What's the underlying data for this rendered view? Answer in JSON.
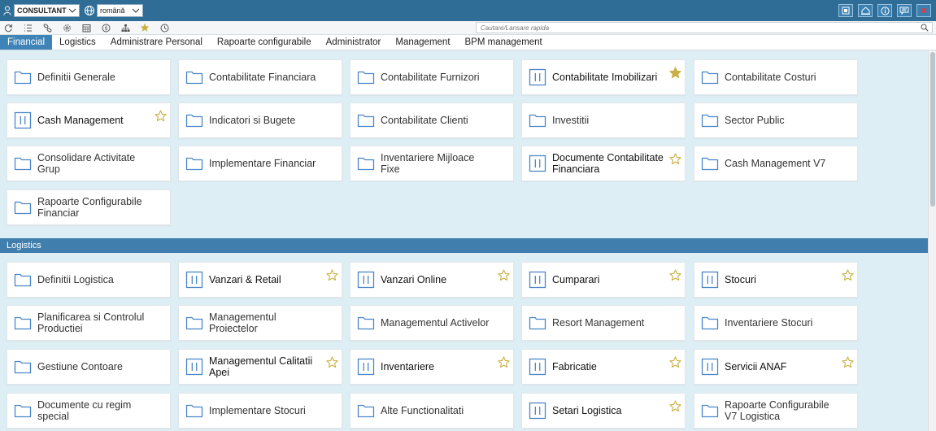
{
  "header": {
    "role_select": "CONSULTANT",
    "language_select": "română",
    "buttons": [
      "window-icon",
      "home-icon",
      "info-icon",
      "message-icon",
      "close-icon"
    ]
  },
  "toolbar": {
    "icons": [
      "refresh-icon",
      "list-icon",
      "link-icon",
      "settings-icon",
      "calendar-icon",
      "currency-icon",
      "org-chart-icon",
      "star-icon",
      "clock-icon"
    ],
    "search_placeholder": "Cautare/Lansare rapida"
  },
  "tabs": [
    {
      "label": "Financial",
      "active": true
    },
    {
      "label": "Logistics",
      "active": false
    },
    {
      "label": "Administrare Personal",
      "active": false
    },
    {
      "label": "Rapoarte configurabile",
      "active": false
    },
    {
      "label": "Administrator",
      "active": false
    },
    {
      "label": "Management",
      "active": false
    },
    {
      "label": "BPM management",
      "active": false
    }
  ],
  "sections": {
    "financial": {
      "tiles": [
        {
          "label": "Definitii Generale",
          "kind": "folder",
          "star": "none"
        },
        {
          "label": "Contabilitate Financiara",
          "kind": "folder",
          "star": "none"
        },
        {
          "label": "Contabilitate Furnizori",
          "kind": "folder",
          "star": "none"
        },
        {
          "label": "Contabilitate Imobilizari",
          "kind": "app",
          "star": "filled"
        },
        {
          "label": "Contabilitate Costuri",
          "kind": "folder",
          "star": "none"
        },
        {
          "label": "Cash Management",
          "kind": "app",
          "star": "outline"
        },
        {
          "label": "Indicatori si Bugete",
          "kind": "folder",
          "star": "none"
        },
        {
          "label": "Contabilitate Clienti",
          "kind": "folder",
          "star": "none"
        },
        {
          "label": "Investitii",
          "kind": "folder",
          "star": "none"
        },
        {
          "label": "Sector Public",
          "kind": "folder",
          "star": "none"
        },
        {
          "label": "Consolidare Activitate Grup",
          "kind": "folder",
          "star": "none"
        },
        {
          "label": "Implementare Financiar",
          "kind": "folder",
          "star": "none"
        },
        {
          "label": "Inventariere Mijloace Fixe",
          "kind": "folder",
          "star": "none"
        },
        {
          "label": "Documente Contabilitate Financiara",
          "kind": "app",
          "star": "outline"
        },
        {
          "label": "Cash Management V7",
          "kind": "folder",
          "star": "none"
        },
        {
          "label": "Rapoarte Configurabile Financiar",
          "kind": "folder",
          "star": "none"
        }
      ]
    },
    "logistics": {
      "title": "Logistics",
      "tiles": [
        {
          "label": "Definitii Logistica",
          "kind": "folder",
          "star": "none"
        },
        {
          "label": "Vanzari & Retail",
          "kind": "app",
          "star": "outline"
        },
        {
          "label": "Vanzari Online",
          "kind": "app",
          "star": "outline"
        },
        {
          "label": "Cumparari",
          "kind": "app",
          "star": "outline"
        },
        {
          "label": "Stocuri",
          "kind": "app",
          "star": "outline"
        },
        {
          "label": "Planificarea si Controlul Productiei",
          "kind": "folder",
          "star": "none"
        },
        {
          "label": "Managementul Proiectelor",
          "kind": "folder",
          "star": "none"
        },
        {
          "label": "Managementul Activelor",
          "kind": "folder",
          "star": "none"
        },
        {
          "label": "Resort Management",
          "kind": "folder",
          "star": "none"
        },
        {
          "label": "Inventariere Stocuri",
          "kind": "folder",
          "star": "none"
        },
        {
          "label": "Gestiune Contoare",
          "kind": "folder",
          "star": "none"
        },
        {
          "label": "Managementul Calitatii Apei",
          "kind": "app",
          "star": "outline"
        },
        {
          "label": "Inventariere",
          "kind": "app",
          "star": "outline"
        },
        {
          "label": "Fabricatie",
          "kind": "app",
          "star": "outline"
        },
        {
          "label": "Servicii ANAF",
          "kind": "app",
          "star": "outline"
        },
        {
          "label": "Documente cu regim special",
          "kind": "folder",
          "star": "none"
        },
        {
          "label": "Implementare Stocuri",
          "kind": "folder",
          "star": "none"
        },
        {
          "label": "Alte Functionalitati",
          "kind": "folder",
          "star": "none"
        },
        {
          "label": "Setari Logistica",
          "kind": "app",
          "star": "outline"
        },
        {
          "label": "Rapoarte Configurabile V7 Logistica",
          "kind": "folder",
          "star": "none"
        }
      ]
    }
  },
  "colors": {
    "header_bg": "#2f6d96",
    "tab_active": "#3f84b8",
    "section_header": "#3f7ead",
    "content_bg": "#ddeef4",
    "icon_blue": "#4a86c8",
    "star_gold": "#c9b044"
  }
}
